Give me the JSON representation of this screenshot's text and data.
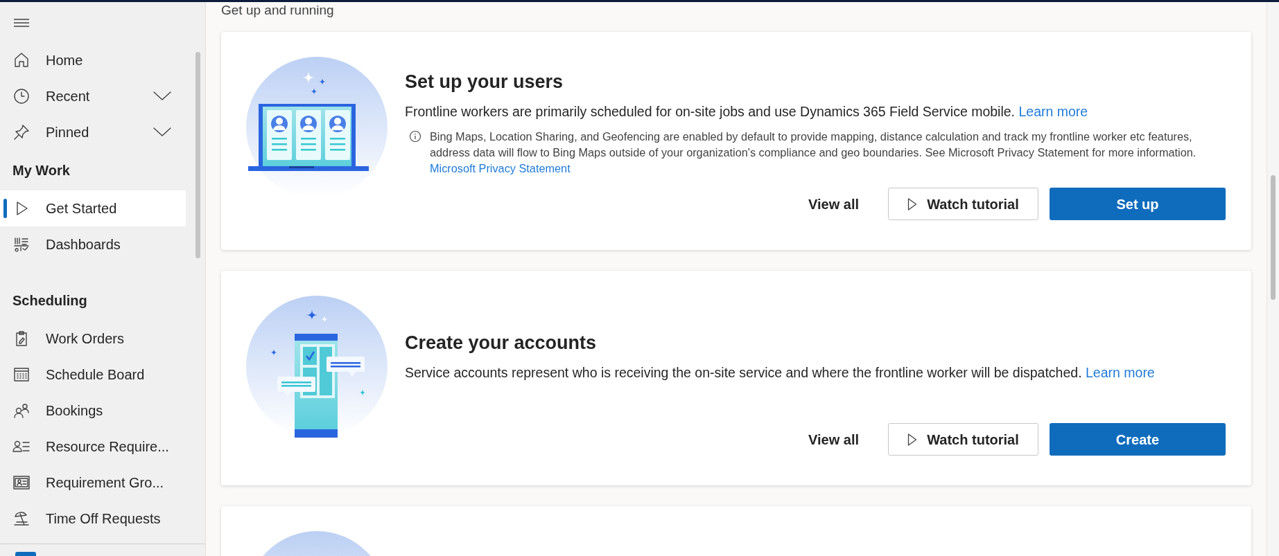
{
  "sidebar": {
    "top_items": [
      {
        "label": "Home",
        "expandable": false,
        "selected": false
      },
      {
        "label": "Recent",
        "expandable": true,
        "selected": false
      },
      {
        "label": "Pinned",
        "expandable": true,
        "selected": false
      }
    ],
    "sections": [
      {
        "title": "My Work",
        "items": [
          {
            "label": "Get Started",
            "selected": true
          },
          {
            "label": "Dashboards",
            "selected": false
          }
        ]
      },
      {
        "title": "Scheduling",
        "items": [
          {
            "label": "Work Orders",
            "selected": false
          },
          {
            "label": "Schedule Board",
            "selected": false
          },
          {
            "label": "Bookings",
            "selected": false
          },
          {
            "label": "Resource Require...",
            "selected": false
          },
          {
            "label": "Requirement Gro...",
            "selected": false
          },
          {
            "label": "Time Off Requests",
            "selected": false
          }
        ]
      }
    ]
  },
  "main": {
    "heading": "Get up and running",
    "cards": [
      {
        "kind": "laptop",
        "title": "Set up your users",
        "description": "Frontline workers are primarily scheduled for on-site jobs and use Dynamics 365 Field Service mobile.",
        "description_link": "Learn more",
        "note": "Bing Maps, Location Sharing, and Geofencing are enabled by default to provide mapping, distance calculation and track my frontline worker etc features, address data will flow to Bing Maps outside of your organization's compliance and geo boundaries. See Microsoft Privacy Statement for more information.",
        "note_link": "Microsoft Privacy Statement",
        "buttons": [
          "View all",
          "Watch tutorial",
          "Set up"
        ]
      },
      {
        "kind": "phone",
        "title": "Create your accounts",
        "description": "Service accounts represent who is receiving the on-site service and where the frontline worker will be dispatched.",
        "description_link": "Learn more",
        "buttons": [
          "View all",
          "Watch tutorial",
          "Create"
        ]
      },
      {
        "kind": "cut-off"
      }
    ]
  }
}
